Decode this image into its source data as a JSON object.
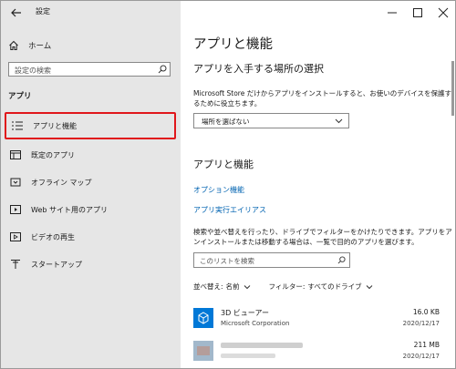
{
  "window": {
    "title": "設定"
  },
  "sidebar": {
    "home_label": "ホーム",
    "search_placeholder": "設定の検索",
    "section_label": "アプリ",
    "items": [
      {
        "label": "アプリと機能",
        "icon": "list-icon",
        "selected": true
      },
      {
        "label": "既定のアプリ",
        "icon": "default-apps-icon",
        "selected": false
      },
      {
        "label": "オフライン マップ",
        "icon": "offline-maps-icon",
        "selected": false
      },
      {
        "label": "Web サイト用のアプリ",
        "icon": "web-apps-icon",
        "selected": false
      },
      {
        "label": "ビデオの再生",
        "icon": "video-icon",
        "selected": false
      },
      {
        "label": "スタートアップ",
        "icon": "startup-icon",
        "selected": false
      }
    ]
  },
  "main": {
    "title": "アプリと機能",
    "install_heading": "アプリを入手する場所の選択",
    "install_desc": "Microsoft Store だけからアプリをインストールすると、お使いのデバイスを保護するために役立ちます。",
    "install_dropdown_value": "場所を選ばない",
    "apps_heading": "アプリと機能",
    "link_optional": "オプション機能",
    "link_aliases": "アプリ実行エイリアス",
    "apps_desc": "検索や並べ替えを行ったり、ドライブでフィルターをかけたりできます。アプリをアンインストールまたは移動する場合は、一覧で目的のアプリを選びます。",
    "list_search_placeholder": "このリストを検索",
    "sort_label": "並べ替え:",
    "sort_value": "名前",
    "filter_label": "フィルター:",
    "filter_value": "すべてのドライブ",
    "apps": [
      {
        "name": "3D ビューアー",
        "publisher": "Microsoft Corporation",
        "size": "16.0 KB",
        "date": "2020/12/17"
      },
      {
        "name": "",
        "publisher": "",
        "size": "211 MB",
        "date": "2020/12/17"
      }
    ]
  },
  "colors": {
    "accent": "#0063b1",
    "highlight_border": "#e0161b",
    "sidebar_bg": "#e6e6e6"
  }
}
